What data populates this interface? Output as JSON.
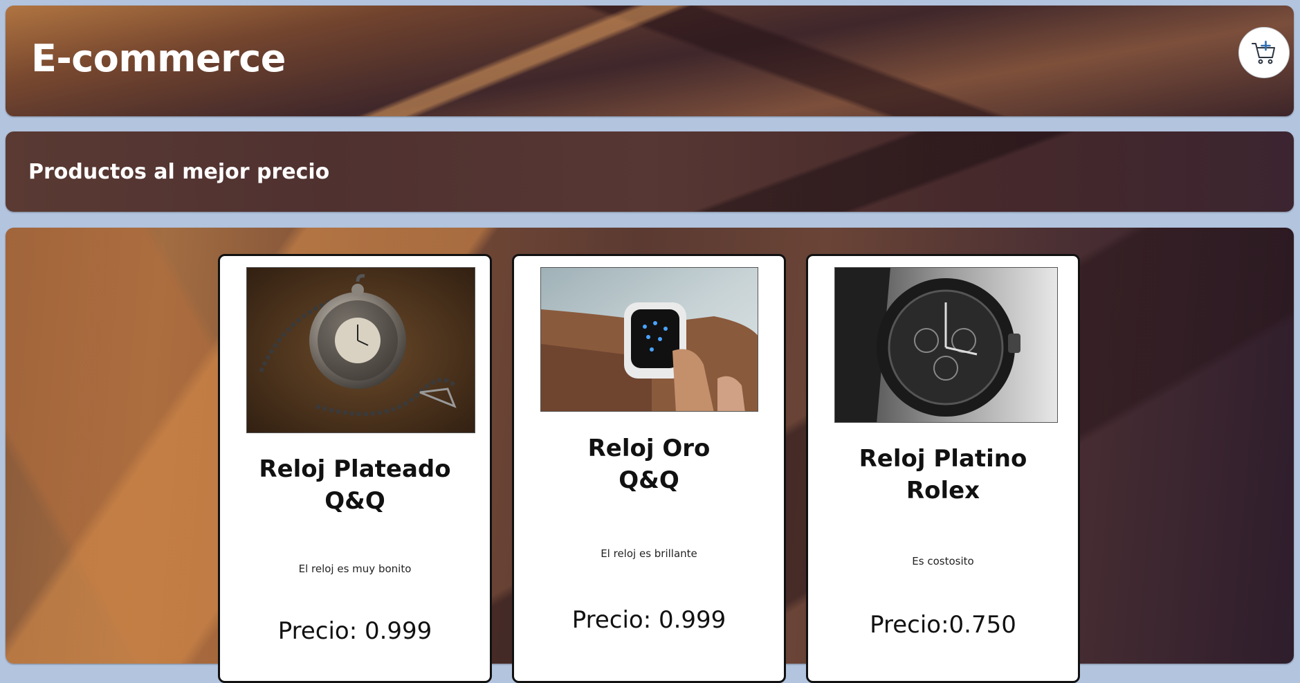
{
  "header": {
    "title": "E-commerce",
    "cart_icon": "cart-add-icon"
  },
  "subheader": {
    "title": "Productos al mejor precio"
  },
  "products": [
    {
      "name": "Reloj Plateado\nQ&Q",
      "description": "El reloj es muy bonito",
      "price": "Precio: 0.999",
      "image": "pocket-watch-photo"
    },
    {
      "name": "Reloj Oro\nQ&Q",
      "description": "El reloj es brillante",
      "price": "Precio: 0.999",
      "image": "smartwatch-photo"
    },
    {
      "name": "Reloj Platino\nRolex",
      "description": "Es costosito",
      "price": "Precio:0.750",
      "image": "black-wristwatch-photo"
    }
  ],
  "colors": {
    "page_background": "#b3c4df",
    "card_background": "#ffffff",
    "card_border": "#111111",
    "cart_accent": "#2f6fb3"
  }
}
